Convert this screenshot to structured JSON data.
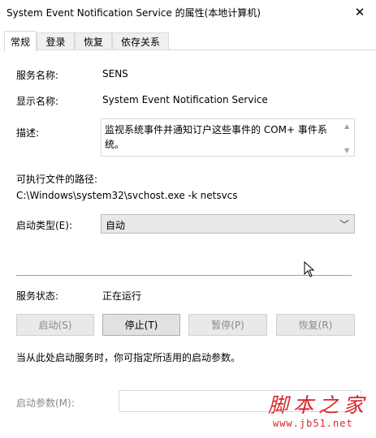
{
  "window": {
    "title": "System Event Notification Service 的属性(本地计算机)",
    "close_glyph": "✕"
  },
  "tabs": [
    {
      "label": "常规"
    },
    {
      "label": "登录"
    },
    {
      "label": "恢复"
    },
    {
      "label": "依存关系"
    }
  ],
  "general": {
    "service_name_label": "服务名称:",
    "service_name": "SENS",
    "display_name_label": "显示名称:",
    "display_name": "System Event Notification Service",
    "description_label": "描述:",
    "description": "监视系统事件并通知订户这些事件的 COM+ 事件系统。",
    "path_label": "可执行文件的路径:",
    "path": "C:\\Windows\\system32\\svchost.exe -k netsvcs",
    "startup_type_label": "启动类型(E):",
    "startup_type": "自动",
    "status_label": "服务状态:",
    "status": "正在运行",
    "buttons": {
      "start": "启动(S)",
      "stop": "停止(T)",
      "pause": "暂停(P)",
      "resume": "恢复(R)"
    },
    "hint": "当从此处启动服务时，你可指定所适用的启动参数。",
    "params_label": "启动参数(M):",
    "params_value": ""
  },
  "watermark": {
    "text": "脚本之家",
    "url": "www.jb51.net"
  }
}
